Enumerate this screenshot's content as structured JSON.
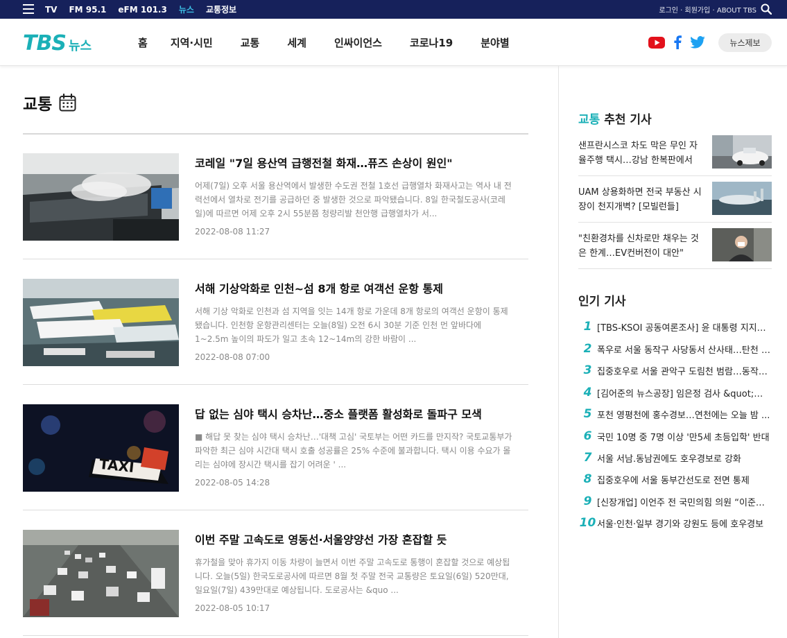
{
  "topbar": {
    "links": [
      {
        "label": "TV",
        "active": false
      },
      {
        "label": "FM 95.1",
        "active": false
      },
      {
        "label": "eFM 101.3",
        "active": false
      },
      {
        "label": "뉴스",
        "active": true
      },
      {
        "label": "교통정보",
        "active": false
      }
    ],
    "right_links": "로그인 · 회원가입 · ABOUT TBS"
  },
  "header": {
    "logo_tbs": "TBS",
    "logo_news": "뉴스",
    "nav": [
      "홈",
      "지역·시민",
      "교통",
      "세계",
      "인싸이언스",
      "코로나19",
      "분야별"
    ],
    "report_button": "뉴스제보"
  },
  "section": {
    "title": "교통"
  },
  "articles": [
    {
      "headline": "코레일 \"7일 용산역 급행전철 화재…퓨즈 손상이 원인\"",
      "summary": "어제(7일) 오후 서울 용산역에서 발생한 수도권 전철 1호선 급행열차 화재사고는 역사 내 전력선에서 열차로 전기를 공급하던 중 발생한 것으로 파악됐습니다. 8일 한국철도공사(코레일)에 따르면 어제 오후 2시 55분쯤 청량리발 천안행 급행열차가 서...",
      "date": "2022-08-08 11:27",
      "thumb": "train"
    },
    {
      "headline": "서해 기상악화로 인천~섬 8개 항로 여객선 운항 통제",
      "summary": "서해 기상 악화로 인천과 섬 지역을 잇는 14개 항로 가운데 8개 항로의 여객선 운항이 통제됐습니다. 인천항 운항관리센터는 오늘(8일) 오전 6시 30분 기준 인천 먼 앞바다에 1~2.5m 높이의 파도가 일고 초속 12~14m의 강한 바람이 ...",
      "date": "2022-08-08 07:00",
      "thumb": "ferry"
    },
    {
      "headline": "답 없는 심야 택시 승차난…중소 플랫폼 활성화로 돌파구 모색",
      "summary": "■ 해답 못 찾는 심야 택시 승차난…'대책 고심' 국토부는 어떤 카드를 만지작? 국토교통부가 파악한 최근 심야 시간대 택시 호출 성공률은 25% 수준에 불과합니다. 택시 이용 수요가 몰리는 심야에 장시간 택시를 잡기 어려운 ' ...",
      "date": "2022-08-05 14:28",
      "thumb": "taxi",
      "thumb_text": "TAXI"
    },
    {
      "headline": "이번 주말 고속도로 영동선·서울양양선 가장 혼잡할 듯",
      "summary": "휴가철을 맞아 휴가지 이동 차량이 늘면서 이번 주말 고속도로 통행이 혼잡할 것으로 예상됩니다. 오늘(5일) 한국도로공사에 따르면 8월 첫 주말 전국 교통량은 토요일(6일) 520만대, 일요일(7일) 439만대로 예상됩니다. 도로공사는 &quo ...",
      "date": "2022-08-05 10:17",
      "thumb": "highway"
    }
  ],
  "sidebar": {
    "recommended_title_hl": "교통",
    "recommended_title_rest": " 추천 기사",
    "recommended": [
      {
        "text": "샌프란시스코 차도 막은 무인 자율주행 택시…강남 한복판에서도?",
        "thumb": "car"
      },
      {
        "text": "UAM 상용화하면 전국 부동산 시장이 천지개벽? [모빌런들]",
        "thumb": "city"
      },
      {
        "text": "\"친환경차를 신차로만 채우는 것은 한계…EV컨버전이 대안\"",
        "thumb": "person"
      }
    ],
    "popular_title": "인기 기사",
    "popular": [
      {
        "num": "1",
        "text": "[TBS-KSOI 공동여론조사] 윤 대통령 지지율..."
      },
      {
        "num": "2",
        "text": "폭우로 서울 동작구 사당동서 산사태…탄천 범람"
      },
      {
        "num": "3",
        "text": "집중호우로 서울 관악구 도림천 범람…동작구 ..."
      },
      {
        "num": "4",
        "text": "[김어준의 뉴스공장] 임은정 검사 &quot;검찰..."
      },
      {
        "num": "5",
        "text": "포천 영평천에 홍수경보…연천에는 오늘 밤 ..."
      },
      {
        "num": "6",
        "text": "국민 10명 중 7명 이상 '만5세 초등입학' 반대"
      },
      {
        "num": "7",
        "text": "서울 서남.동남권에도 호우경보로 강화"
      },
      {
        "num": "8",
        "text": "집중호우에 서울 동부간선도로 전면 통제"
      },
      {
        "num": "9",
        "text": "[신장개업] 이언주 전 국민의힘 의원 “이준석..."
      },
      {
        "num": "10",
        "text": "서울·인천·일부 경기와 강원도 등에 호우경보"
      }
    ]
  },
  "colors": {
    "topbar_bg": "#16215b",
    "accent": "#1bb0b7",
    "active_link": "#3cc0e6"
  }
}
